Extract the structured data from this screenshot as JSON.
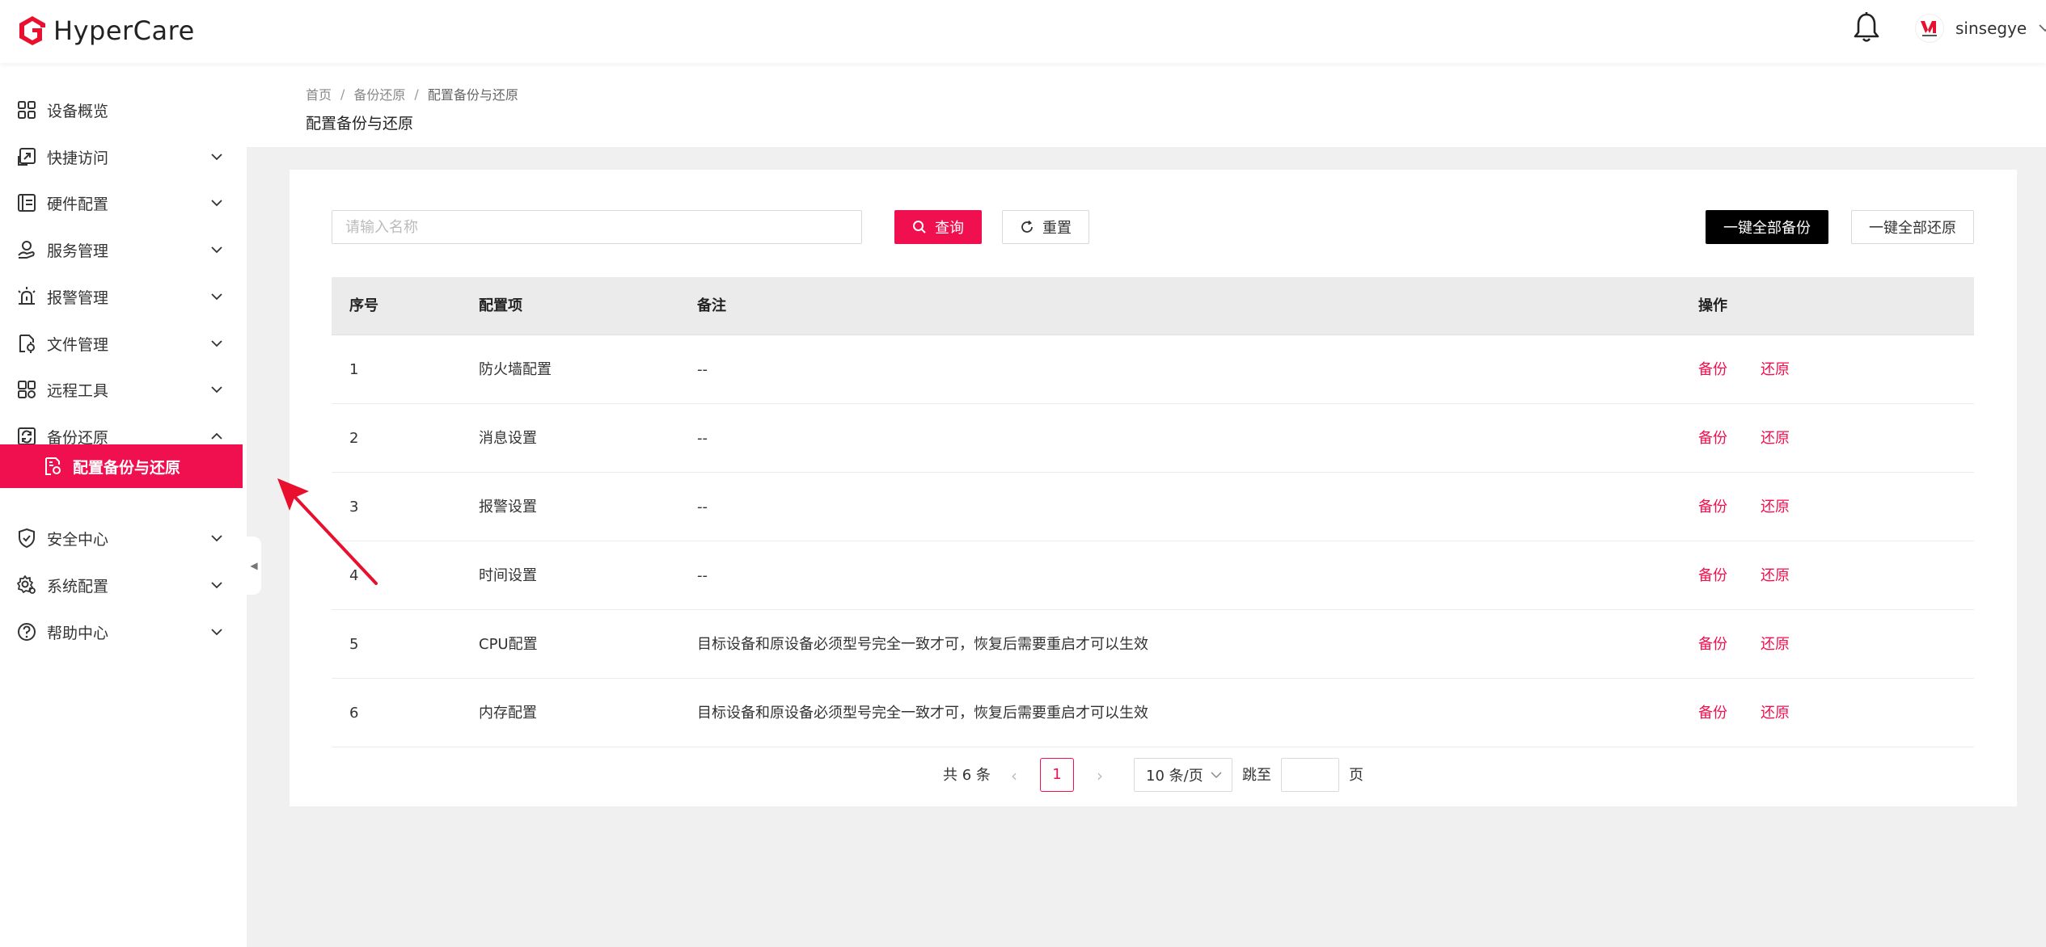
{
  "app": {
    "brand": "HyperCare",
    "brand_color": "#f0104f",
    "username": "sinsegye"
  },
  "sidebar": {
    "items": [
      {
        "label": "设备概览",
        "icon": "dashboard-icon",
        "expandable": false
      },
      {
        "label": "快捷访问",
        "icon": "quick-access-icon",
        "expandable": true
      },
      {
        "label": "硬件配置",
        "icon": "hardware-icon",
        "expandable": true
      },
      {
        "label": "服务管理",
        "icon": "service-icon",
        "expandable": true
      },
      {
        "label": "报警管理",
        "icon": "alarm-icon",
        "expandable": true
      },
      {
        "label": "文件管理",
        "icon": "file-icon",
        "expandable": true
      },
      {
        "label": "远程工具",
        "icon": "remote-tools-icon",
        "expandable": true
      },
      {
        "label": "备份还原",
        "icon": "backup-icon",
        "expanded": true
      },
      {
        "label": "安全中心",
        "icon": "shield-icon",
        "expandable": true
      },
      {
        "label": "系统配置",
        "icon": "settings-icon",
        "expandable": true
      },
      {
        "label": "帮助中心",
        "icon": "help-icon",
        "expandable": true
      }
    ],
    "active_sub_item": {
      "label": "配置备份与还原",
      "icon": "config-backup-icon"
    }
  },
  "breadcrumb": [
    "首页",
    "备份还原",
    "配置备份与还原"
  ],
  "page_title": "配置备份与还原",
  "toolbar": {
    "search_placeholder": "请输入名称",
    "search_value": "",
    "query_label": "查询",
    "reset_label": "重置",
    "backup_all_label": "一键全部备份",
    "restore_all_label": "一键全部还原"
  },
  "table": {
    "headers": {
      "index": "序号",
      "name": "配置项",
      "note": "备注",
      "ops": "操作"
    },
    "op_backup": "备份",
    "op_restore": "还原",
    "rows": [
      {
        "index": "1",
        "name": "防火墙配置",
        "note": "--"
      },
      {
        "index": "2",
        "name": "消息设置",
        "note": "--"
      },
      {
        "index": "3",
        "name": "报警设置",
        "note": "--"
      },
      {
        "index": "4",
        "name": "时间设置",
        "note": "--"
      },
      {
        "index": "5",
        "name": "CPU配置",
        "note": "目标设备和原设备必须型号完全一致才可，恢复后需要重启才可以生效"
      },
      {
        "index": "6",
        "name": "内存配置",
        "note": "目标设备和原设备必须型号完全一致才可，恢复后需要重启才可以生效"
      }
    ]
  },
  "pagination": {
    "total_text": "共 6 条",
    "current_page": "1",
    "page_size": "10 条/页",
    "jump_label": "跳至",
    "page_label": "页"
  }
}
